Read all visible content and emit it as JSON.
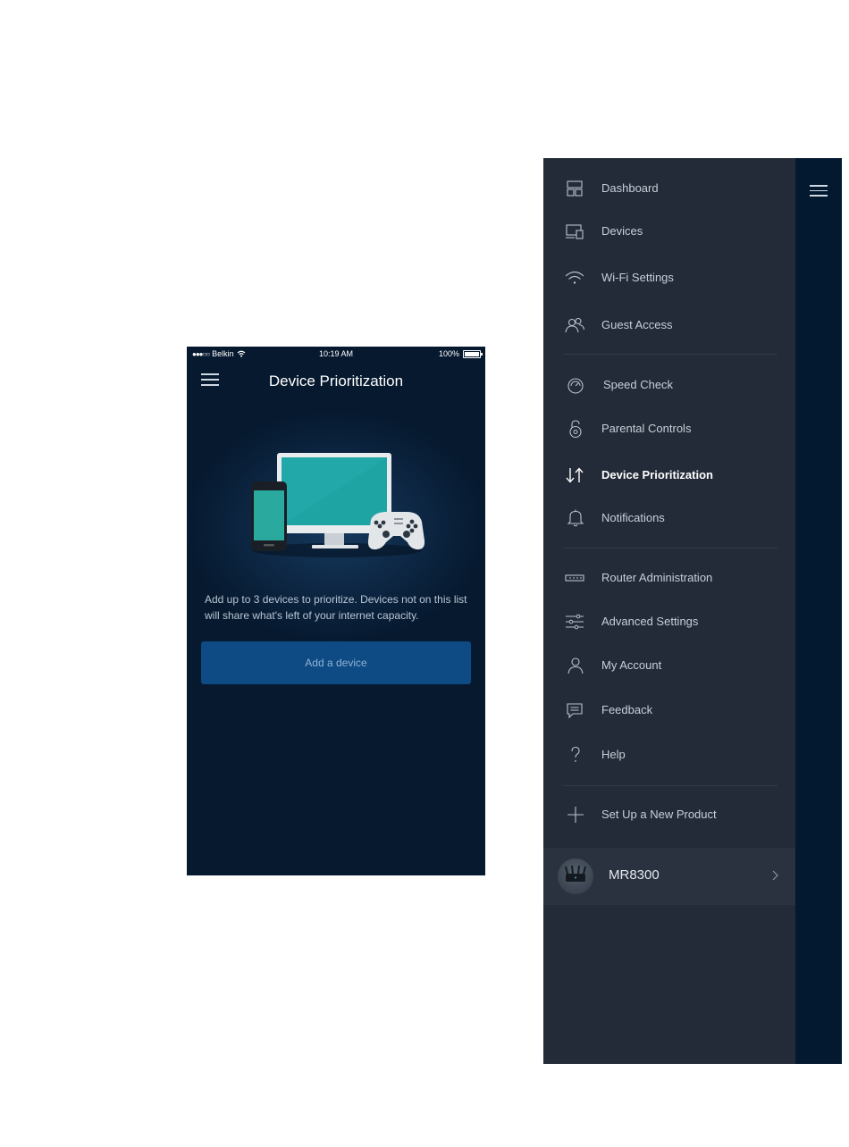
{
  "phone": {
    "status": {
      "carrier": "Belkin",
      "signal_dots": "●●●○○",
      "time": "10:19 AM",
      "battery": "100%"
    },
    "title": "Device Prioritization",
    "description": "Add up to 3 devices to prioritize. Devices not on this list will share what's left of your internet capacity.",
    "add_button": "Add a device"
  },
  "drawer": {
    "items": [
      {
        "label": "Dashboard",
        "icon": "dashboard-icon"
      },
      {
        "label": "Devices",
        "icon": "devices-icon"
      },
      {
        "label": "Wi-Fi Settings",
        "icon": "wifi-icon"
      },
      {
        "label": "Guest Access",
        "icon": "guest-icon"
      },
      {
        "label": "Speed Check",
        "icon": "speedometer-icon"
      },
      {
        "label": "Parental Controls",
        "icon": "lock-icon"
      },
      {
        "label": "Device Prioritization",
        "icon": "priority-arrows-icon",
        "active": true
      },
      {
        "label": "Notifications",
        "icon": "bell-icon"
      },
      {
        "label": "Router Administration",
        "icon": "router-icon"
      },
      {
        "label": "Advanced Settings",
        "icon": "sliders-icon"
      },
      {
        "label": "My Account",
        "icon": "user-icon"
      },
      {
        "label": "Feedback",
        "icon": "chat-icon"
      },
      {
        "label": "Help",
        "icon": "help-icon"
      },
      {
        "label": "Set Up a New Product",
        "icon": "plus-icon"
      }
    ],
    "device": {
      "name": "MR8300"
    }
  },
  "colors": {
    "phone_bg": "#06192f",
    "drawer_bg": "#232b38",
    "rail_bg": "#03192f",
    "button_bg": "#0e4a84",
    "screen_teal": "#1fa4a4"
  }
}
